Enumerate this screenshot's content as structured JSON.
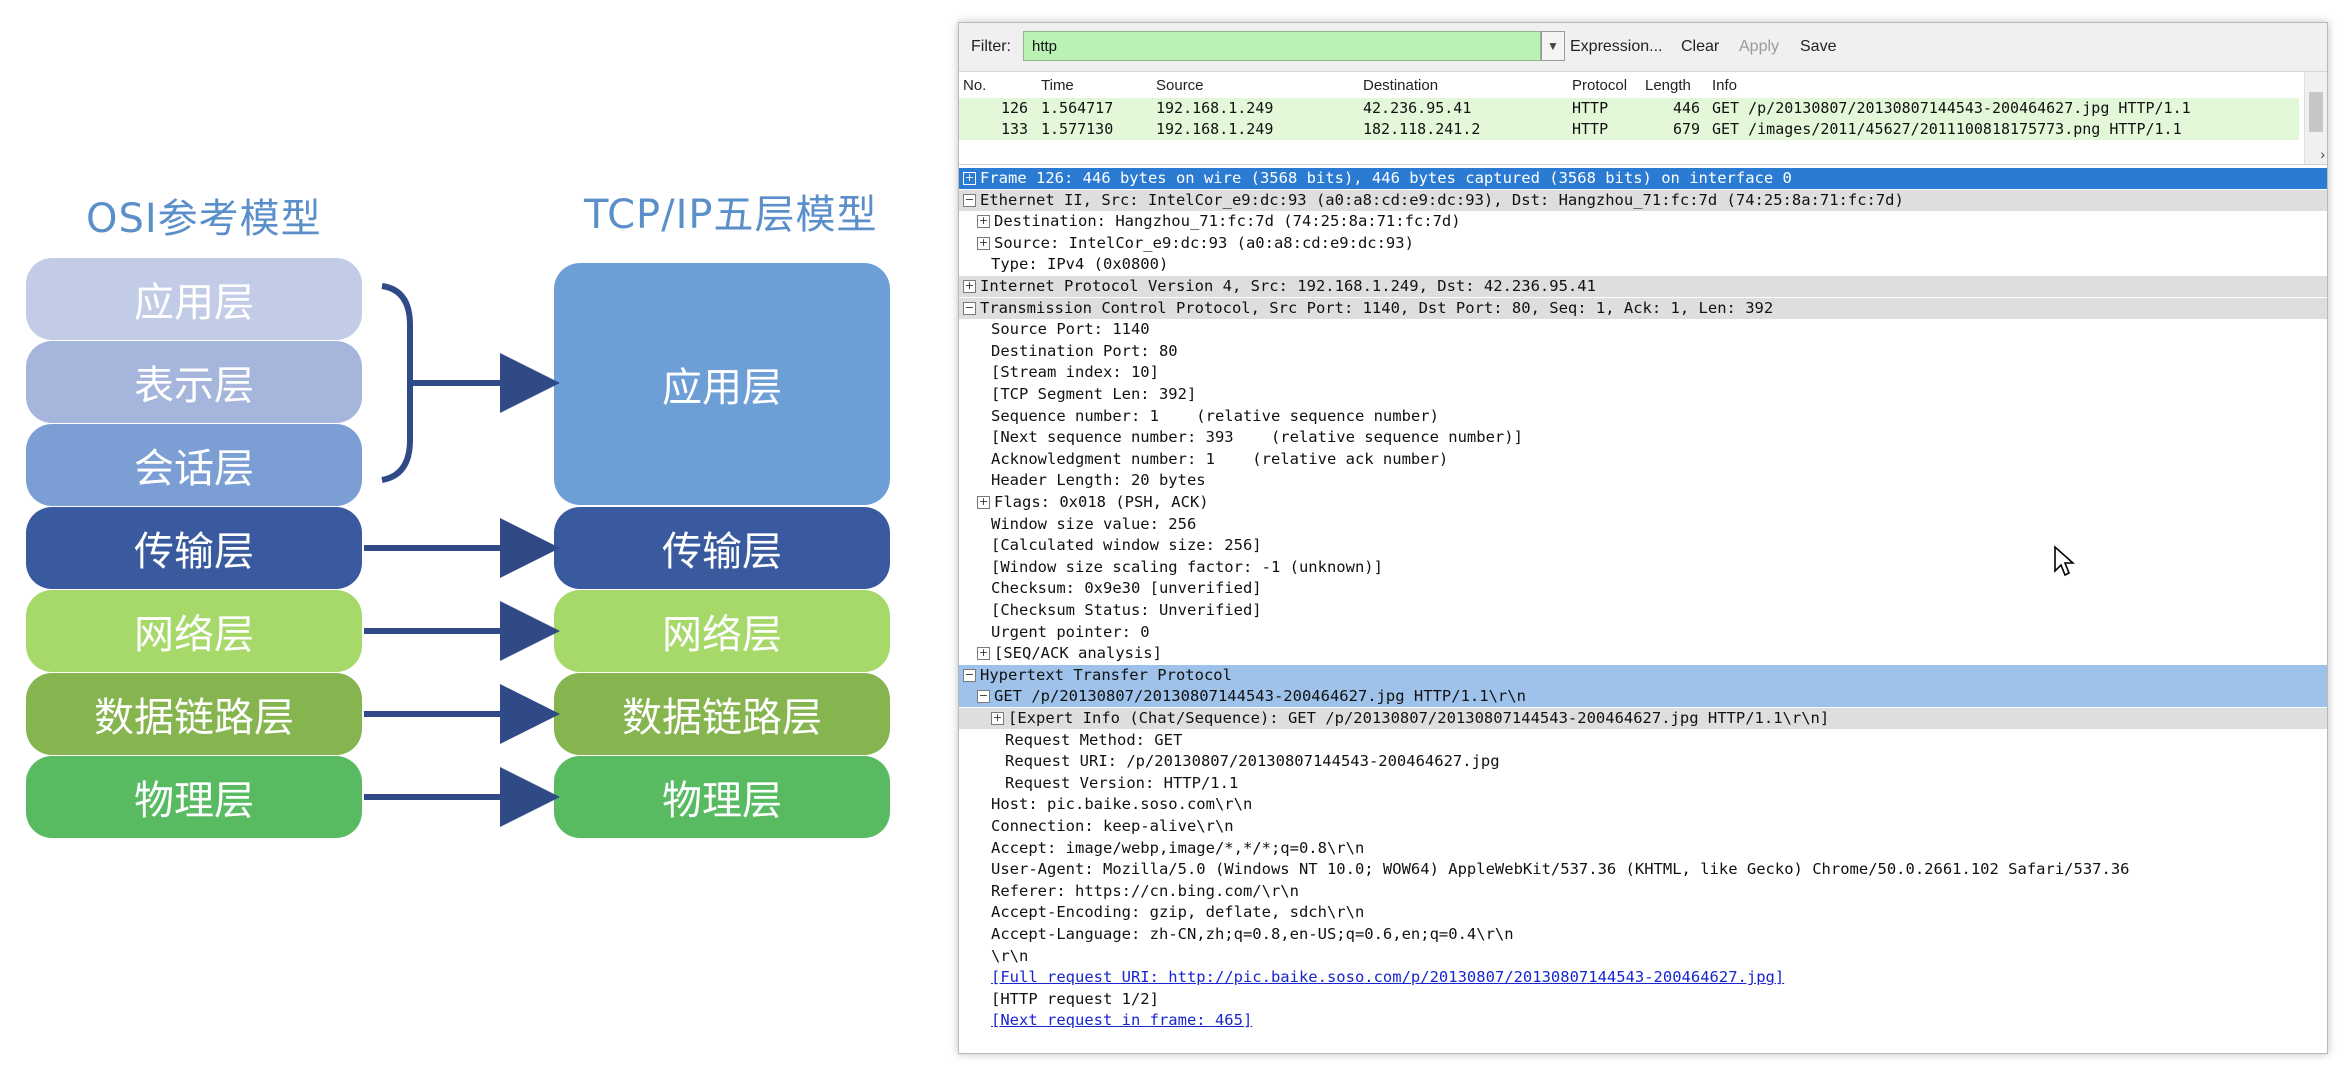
{
  "diagram": {
    "osi_title": "OSI参考模型",
    "tcp_title": "TCP/IP五层模型",
    "osi_layers": [
      {
        "label": "应用层",
        "color": "#c3cce6"
      },
      {
        "label": "表示层",
        "color": "#a6b5dc"
      },
      {
        "label": "会话层",
        "color": "#7b9fd5"
      },
      {
        "label": "传输层",
        "color": "#3a5a9f"
      },
      {
        "label": "网络层",
        "color": "#a6d86a"
      },
      {
        "label": "数据链路层",
        "color": "#86b44e"
      },
      {
        "label": "物理层",
        "color": "#58bb62"
      }
    ],
    "tcp_layers": [
      {
        "label": "应用层",
        "color": "#6d9fd6"
      },
      {
        "label": "传输层",
        "color": "#3a5a9f"
      },
      {
        "label": "网络层",
        "color": "#a6d86a"
      },
      {
        "label": "数据链路层",
        "color": "#86b44e"
      },
      {
        "label": "物理层",
        "color": "#58bb62"
      }
    ],
    "arrow_color": "#2f4a86"
  },
  "wireshark": {
    "filter": {
      "label": "Filter:",
      "value": "http",
      "buttons": [
        "Expression...",
        "Clear",
        "Apply",
        "Save"
      ],
      "input_color": "#b9f2b3"
    },
    "packet_list": {
      "columns": [
        "No.",
        "Time",
        "Source",
        "Destination",
        "Protocol",
        "Length",
        "Info"
      ],
      "rows": [
        [
          "126",
          "1.564717",
          "192.168.1.249",
          "42.236.95.41",
          "HTTP",
          "446",
          "GET /p/20130807/20130807144543-200464627.jpg HTTP/1.1"
        ],
        [
          "133",
          "1.577130",
          "192.168.1.249",
          "182.118.241.2",
          "HTTP",
          "679",
          "GET /images/2011/45627/2011100818175773.png HTTP/1.1"
        ]
      ]
    },
    "details": [
      {
        "text": "Frame 126: 446 bytes on wire (3568 bits), 446 bytes captured (3568 bits) on interface 0",
        "toggle": "+",
        "style": "sel"
      },
      {
        "text": "Ethernet II, Src: IntelCor_e9:dc:93 (a0:a8:cd:e9:dc:93), Dst: Hangzhou_71:fc:7d (74:25:8a:71:fc:7d)",
        "toggle": "−",
        "style": "hdr"
      },
      {
        "text": "Destination: Hangzhou_71:fc:7d (74:25:8a:71:fc:7d)",
        "toggle": "+",
        "indent": 1
      },
      {
        "text": "Source: IntelCor_e9:dc:93 (a0:a8:cd:e9:dc:93)",
        "toggle": "+",
        "indent": 1
      },
      {
        "text": "Type: IPv4 (0x0800)",
        "indent": 2
      },
      {
        "text": "Internet Protocol Version 4, Src: 192.168.1.249, Dst: 42.236.95.41",
        "toggle": "+",
        "style": "hdr"
      },
      {
        "text": "Transmission Control Protocol, Src Port: 1140, Dst Port: 80, Seq: 1, Ack: 1, Len: 392",
        "toggle": "−",
        "style": "hdr"
      },
      {
        "text": "Source Port: 1140",
        "indent": 2
      },
      {
        "text": "Destination Port: 80",
        "indent": 2
      },
      {
        "text": "[Stream index: 10]",
        "indent": 2
      },
      {
        "text": "[TCP Segment Len: 392]",
        "indent": 2
      },
      {
        "text": "Sequence number: 1    (relative sequence number)",
        "indent": 2
      },
      {
        "text": "[Next sequence number: 393    (relative sequence number)]",
        "indent": 2
      },
      {
        "text": "Acknowledgment number: 1    (relative ack number)",
        "indent": 2
      },
      {
        "text": "Header Length: 20 bytes",
        "indent": 2
      },
      {
        "text": "Flags: 0x018 (PSH, ACK)",
        "toggle": "+",
        "indent": 1
      },
      {
        "text": "Window size value: 256",
        "indent": 2
      },
      {
        "text": "[Calculated window size: 256]",
        "indent": 2
      },
      {
        "text": "[Window size scaling factor: -1 (unknown)]",
        "indent": 2
      },
      {
        "text": "Checksum: 0x9e30 [unverified]",
        "indent": 2
      },
      {
        "text": "[Checksum Status: Unverified]",
        "indent": 2
      },
      {
        "text": "Urgent pointer: 0",
        "indent": 2
      },
      {
        "text": "[SEQ/ACK analysis]",
        "toggle": "+",
        "indent": 1
      },
      {
        "text": "Hypertext Transfer Protocol",
        "toggle": "−",
        "style": "hl"
      },
      {
        "text": "GET /p/20130807/20130807144543-200464627.jpg HTTP/1.1\\r\\n",
        "toggle": "−",
        "indent": 1,
        "style": "hl"
      },
      {
        "text": "[Expert Info (Chat/Sequence): GET /p/20130807/20130807144543-200464627.jpg HTTP/1.1\\r\\n]",
        "toggle": "+",
        "indent": 2,
        "style": "hdr"
      },
      {
        "text": "Request Method: GET",
        "indent": 3
      },
      {
        "text": "Request URI: /p/20130807/20130807144543-200464627.jpg",
        "indent": 3
      },
      {
        "text": "Request Version: HTTP/1.1",
        "indent": 3
      },
      {
        "text": "Host: pic.baike.soso.com\\r\\n",
        "indent": 2
      },
      {
        "text": "Connection: keep-alive\\r\\n",
        "indent": 2
      },
      {
        "text": "Accept: image/webp,image/*,*/*;q=0.8\\r\\n",
        "indent": 2
      },
      {
        "text": "User-Agent: Mozilla/5.0 (Windows NT 10.0; WOW64) AppleWebKit/537.36 (KHTML, like Gecko) Chrome/50.0.2661.102 Safari/537.36",
        "indent": 2
      },
      {
        "text": "Referer: https://cn.bing.com/\\r\\n",
        "indent": 2
      },
      {
        "text": "Accept-Encoding: gzip, deflate, sdch\\r\\n",
        "indent": 2
      },
      {
        "text": "Accept-Language: zh-CN,zh;q=0.8,en-US;q=0.6,en;q=0.4\\r\\n",
        "indent": 2
      },
      {
        "text": "\\r\\n",
        "indent": 2
      },
      {
        "text": "[Full request URI: http://pic.baike.soso.com/p/20130807/20130807144543-200464627.jpg]",
        "indent": 2,
        "style": "link"
      },
      {
        "text": "[HTTP request 1/2]",
        "indent": 2
      },
      {
        "text": "[Next request in frame: 465]",
        "indent": 2,
        "style": "link"
      }
    ]
  }
}
